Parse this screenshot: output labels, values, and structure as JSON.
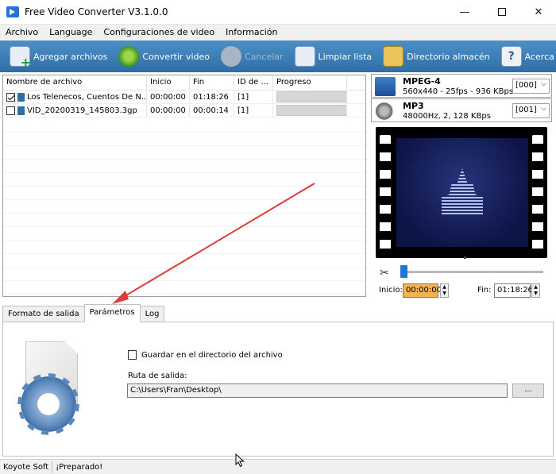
{
  "window": {
    "title": "Free Video Converter V3.1.0.0",
    "minimize": "—",
    "close": "✕"
  },
  "menu": [
    "Archivo",
    "Language",
    "Configuraciones de video",
    "Información"
  ],
  "toolbar": {
    "add": "Agregar archivos",
    "convert": "Convertir video",
    "cancel": "Cancelar",
    "clear": "Limpiar lista",
    "folder": "Directorio almacén",
    "about": "Acerca de",
    "about_icon": "?"
  },
  "file_list": {
    "columns": [
      "Nombre de archivo",
      "Inicio",
      "Fin",
      "ID de ...",
      "Progreso"
    ],
    "rows": [
      {
        "checked": true,
        "name": "Los Telenecos, Cuentos De N...",
        "inicio": "00:00:00",
        "fin": "01:18:26",
        "id": "[1]"
      },
      {
        "checked": false,
        "name": "VID_20200319_145803.3gp",
        "inicio": "00:00:00",
        "fin": "00:00:14",
        "id": "[1]"
      }
    ]
  },
  "formats": {
    "video": {
      "name": "MPEG-4",
      "detail": "560x440 - 25fps - 936 KBps",
      "select": "[000]"
    },
    "audio": {
      "name": "MP3",
      "detail": "48000Hz, 2, 128 KBps",
      "select": "[001]"
    }
  },
  "trim": {
    "inicio_label": "Inicio:",
    "inicio_value": "00:00:00",
    "fin_label": "Fin:",
    "fin_value": "01:18:26",
    "slider_position": 0
  },
  "tabs": [
    "Formato de salida",
    "Parámetros",
    "Log"
  ],
  "active_tab": "Parámetros",
  "parametros": {
    "save_in_source_label": "Guardar en el directorio del archivo",
    "save_in_source_checked": false,
    "ruta_label": "Ruta de salida:",
    "ruta_value": "C:\\Users\\Fran\\Desktop\\",
    "browse_label": "..."
  },
  "status": {
    "company": "Koyote Soft",
    "message": "¡Preparado!"
  },
  "colors": {
    "toolbar": "#3a7fb8",
    "time_highlight": "#f4b350",
    "slider_thumb": "#1f78d1",
    "annotation_arrow": "#e03a3a"
  }
}
